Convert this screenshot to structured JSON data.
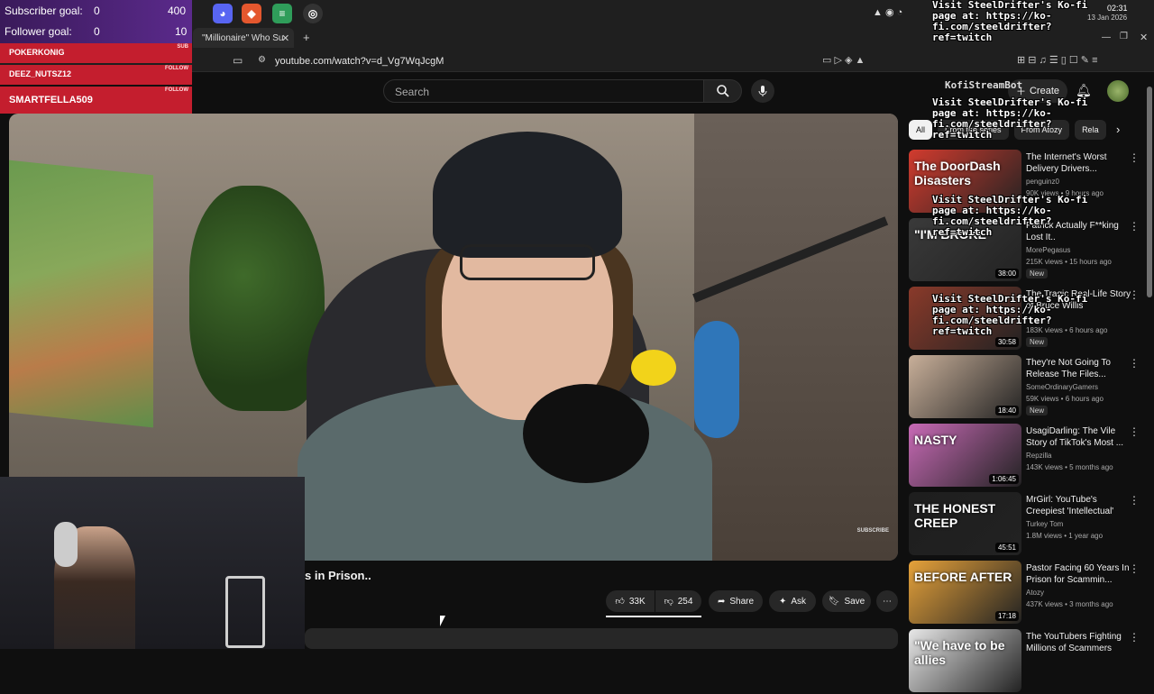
{
  "browser": {
    "tab_label": "\"Millionaire\" Who Su",
    "url": "youtube.com/watch?v=d_Vg7WqJcgM",
    "clock_time": "02:31",
    "clock_date": "13 Jan 2026"
  },
  "overlay": {
    "subscriber_goal_label": "Subscriber goal:",
    "subscriber_goal_current": "0",
    "subscriber_goal_target": "400",
    "follower_goal_label": "Follower goal:",
    "follower_goal_current": "0",
    "follower_goal_target": "10",
    "alerts": [
      {
        "name": "POKERKONIG",
        "kind": "SUB"
      },
      {
        "name": "DEEZ_NUTSZ12",
        "kind": "FOLLOW"
      },
      {
        "name": "SMARTFELLA509",
        "kind": "FOLLOW"
      }
    ],
    "kofi_bot_name": "KofiStreamBot",
    "kofi_message": "Visit SteelDrifter's Ko-fi\npage at: https://ko-\nfi.com/steeldrifter?\nref=twitch"
  },
  "youtube": {
    "search_placeholder": "Search",
    "create_label": "Create",
    "video_title": "s in Prison..",
    "subscribe_watermark": "SUBSCRIBE",
    "likes": "33K",
    "dislikes": "254",
    "share_label": "Share",
    "ask_label": "Ask",
    "save_label": "Save",
    "chips": [
      "All",
      "From the series",
      "From Atozy",
      "Rela"
    ],
    "recommendations": [
      {
        "title": "The Internet's Worst Delivery Drivers...",
        "channel": "penguinz0",
        "meta": "90K views • 9 hours ago",
        "duration": "",
        "thumb_text": "The DoorDash Disasters",
        "new": "",
        "thumb_color": "#d23b2e"
      },
      {
        "title": "Patrick Actually F**king Lost It..",
        "channel": "MorePegasus",
        "meta": "215K views • 15 hours ago",
        "duration": "38:00",
        "thumb_text": "\"I'M BROKE\"",
        "new": "New",
        "thumb_color": "#3a3a3a"
      },
      {
        "title": "The Tragic Real-Life Story of Bruce Willis",
        "channel": "",
        "meta": "183K views • 6 hours ago",
        "duration": "30:58",
        "thumb_text": "",
        "new": "New",
        "thumb_color": "#8a3a2a"
      },
      {
        "title": "They're Not Going To Release The Files...",
        "channel": "SomeOrdinaryGamers",
        "meta": "59K views • 6 hours ago",
        "duration": "18:40",
        "thumb_text": "",
        "new": "New",
        "thumb_color": "#c9b09a"
      },
      {
        "title": "UsagiDarling: The Vile Story of TikTok's Most ...",
        "channel": "Repzilla",
        "meta": "143K views • 5 months ago",
        "duration": "1:06:45",
        "thumb_text": "NASTY",
        "new": "",
        "thumb_color": "#c86ab6"
      },
      {
        "title": "MrGirl: YouTube's Creepiest 'Intellectual'",
        "channel": "Turkey Tom",
        "meta": "1.8M views • 1 year ago",
        "duration": "45:51",
        "thumb_text": "THE HONEST CREEP",
        "new": "",
        "thumb_color": "#1e1e1e"
      },
      {
        "title": "Pastor Facing 60 Years In Prison for Scammin...",
        "channel": "Atozy",
        "meta": "437K views • 3 months ago",
        "duration": "17:18",
        "thumb_text": "BEFORE  AFTER",
        "new": "",
        "thumb_color": "#e6a23a"
      },
      {
        "title": "The YouTubers Fighting Millions of Scammers",
        "channel": "",
        "meta": "",
        "duration": "",
        "thumb_text": "\"We have to be allies",
        "new": "",
        "thumb_color": "#e8e8e8"
      }
    ]
  }
}
